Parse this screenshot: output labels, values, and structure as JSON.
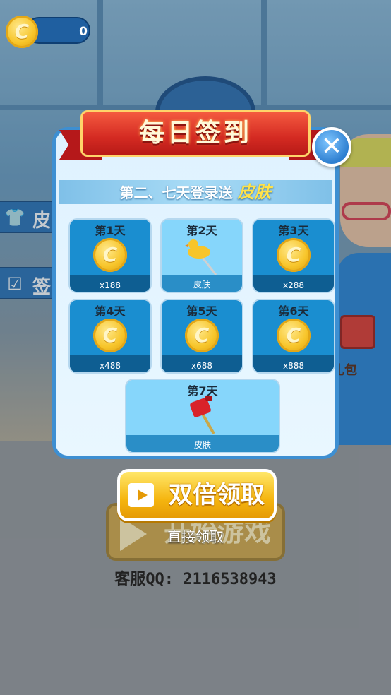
{
  "coin_counter": {
    "value": "0"
  },
  "side_menu": {
    "items": [
      {
        "icon": "shirt-icon",
        "label": "皮"
      },
      {
        "icon": "calendar-check-icon",
        "label": "签"
      }
    ]
  },
  "modal": {
    "title": "每日签到",
    "subtitle_prefix": "第二、七天登录送",
    "subtitle_highlight": "皮肤",
    "days": [
      {
        "title": "第1天",
        "reward": "x188",
        "type": "coin"
      },
      {
        "title": "第2天",
        "reward": "皮肤",
        "type": "skin-duck"
      },
      {
        "title": "第3天",
        "reward": "x288",
        "type": "coin"
      },
      {
        "title": "第4天",
        "reward": "x488",
        "type": "coin"
      },
      {
        "title": "第5天",
        "reward": "x688",
        "type": "coin"
      },
      {
        "title": "第6天",
        "reward": "x888",
        "type": "coin"
      },
      {
        "title": "第7天",
        "reward": "皮肤",
        "type": "skin-red"
      }
    ]
  },
  "buttons": {
    "double_claim": "双倍领取",
    "direct_claim": "直接领取",
    "start_game": "开始游戏"
  },
  "gift_label": "礼包",
  "customer_service": "客服QQ: 2116538943",
  "colors": {
    "accent_blue": "#2b73b8",
    "gold": "#f5b50f",
    "ribbon_red": "#d42a22"
  }
}
